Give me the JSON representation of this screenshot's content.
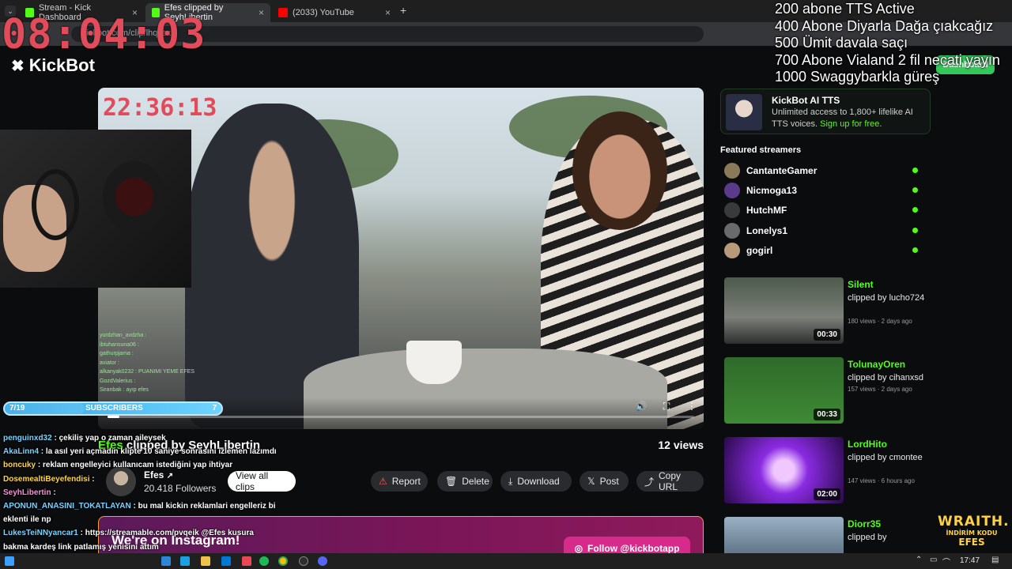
{
  "browser": {
    "tabs": [
      {
        "label": "Stream - Kick Dashboard",
        "color": "#53fc18"
      },
      {
        "label": "Efes clipped by SeyhLibertin",
        "color": "#53fc18"
      },
      {
        "label": "(2033) YouTube",
        "color": "#ff0000"
      }
    ],
    "url": "kickbot.com/clip/lhqxsx"
  },
  "overlay": {
    "big_timer": "08:04:03",
    "small_timer": "22:36:13",
    "goals": [
      "200 abone TTS Active",
      "400 Abone Diyarla Dağa çıakcağız",
      "500 Ümit davala saçı",
      "700 Abone Vialand 2 fil necati yayın",
      "1000 Swaggybarkla güreş"
    ],
    "subbar": {
      "left": "7/19",
      "label": "SUBSCRIBERS",
      "right": "7",
      "progress": 0.37
    }
  },
  "site": {
    "logo": "KickBot",
    "dashboard_label": "Dashboard"
  },
  "player": {
    "progress": 0.02,
    "overlay_chat": [
      "yurdzhan_avdzha :",
      "ibtuhansuna06 :",
      "gathurpjama :",
      "aviator :",
      "alkanyak0232 : PUANIMI YEME EFES",
      "GozdValerius :",
      "Siranbak : ayıp efes"
    ]
  },
  "clip": {
    "title_highlight": "Efes",
    "title_rest": " clipped by SeyhLibertin",
    "views": "12 views",
    "streamer": "Efes",
    "followers": "20.418 Followers",
    "view_all": "View all clips",
    "actions": {
      "report": "Report",
      "delete": "Delete",
      "download": "Download",
      "post": "Post",
      "copy": "Copy URL"
    }
  },
  "chat": [
    {
      "user": "penguinxd32",
      "msg": " : çekiliş yap o zaman aileysek",
      "tone": ""
    },
    {
      "user": "AkaLinn4",
      "msg": " : la asıl yeri açmadın klipte 10 saniye sonrasını izlemen lazımdı",
      "tone": ""
    },
    {
      "user": "boncuky",
      "msg": " : reklam engelleyici kullanıcam istediğini yap ihtiyar",
      "tone": "g"
    },
    {
      "user": "DosemealtiBeyefendisi",
      "msg": " :",
      "tone": "g"
    },
    {
      "user": "SeyhLibertin",
      "msg": " :",
      "tone": "r"
    },
    {
      "user": "APONUN_ANASINI_TOKATLAYAN",
      "msg": " : bu mal kickin reklamlari engelleriz bi eklenti ile np",
      "tone": ""
    },
    {
      "user": "LukesTeiNNyancar1",
      "msg": " : https://streamable.com/pvqeik @Efes kusura",
      "tone": ""
    },
    {
      "user": "",
      "msg": "bakma kardeş link patlamış yenisini attım",
      "tone": ""
    }
  ],
  "instagram": {
    "text": "We're on Instagram!",
    "button": "Follow @kickbotapp"
  },
  "sidebar": {
    "tts_title": "KickBot AI TTS",
    "tts_desc": "Unlimited access to 1,800+ lifelike AI TTS voices.",
    "tts_link": "Sign up for free",
    "tts_end": ".",
    "featured_title": "Featured streamers",
    "streamers": [
      {
        "name": "CantanteGamer",
        "color": "#8a7a5a"
      },
      {
        "name": "Nicmoga13",
        "color": "#5a3a8a"
      },
      {
        "name": "HutchMF",
        "color": "#3a3a3a"
      },
      {
        "name": "Lonelys1",
        "color": "#6a6a6a"
      },
      {
        "name": "gogirl",
        "color": "#b89a7a"
      }
    ],
    "clips": [
      {
        "name": "Silent",
        "by": "clipped by lucho724",
        "meta": "180 views · 2 days ago",
        "duration": "00:30",
        "bg": "linear-gradient(180deg,#4d5a4c,#7d807a 60%,#2d2f2f)"
      },
      {
        "name": "TolunayOren",
        "by": "clipped by cihanxsd",
        "meta": "157 views · 2 days ago",
        "duration": "00:33",
        "bg": "linear-gradient(180deg,#2f6a2b,#3f8a35)"
      },
      {
        "name": "LordHito",
        "by": "clipped by cmontee",
        "meta": "147 views · 6 hours ago",
        "duration": "02:00",
        "bg": "radial-gradient(circle at 50% 50%,#f0c8ff 0 15%,#8a2be2 35%,#2a0a4a 100%)"
      },
      {
        "name": "Diorr35",
        "by": "clipped by",
        "meta": "",
        "duration": "",
        "bg": "linear-gradient(180deg,#9ab0c4,#36475a)"
      }
    ]
  },
  "promo": {
    "line1": "WRAITH.",
    "line2": "İNDİRİM KODU",
    "line3": "EFES"
  },
  "taskbar": {
    "time": "17:47"
  }
}
